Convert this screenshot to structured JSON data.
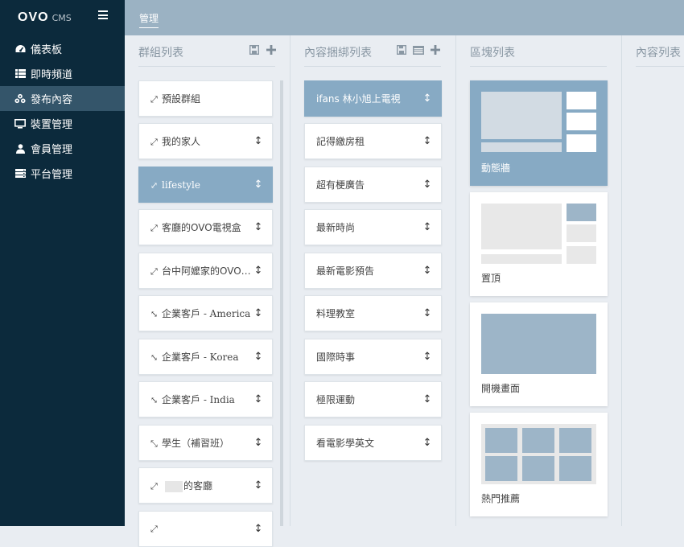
{
  "brand": {
    "logo": "OVO",
    "sub": "CMS"
  },
  "nav": [
    {
      "label": "儀表板",
      "icon": "dashboard-icon"
    },
    {
      "label": "即時頻道",
      "icon": "list-icon"
    },
    {
      "label": "發布內容",
      "icon": "share-nodes-icon",
      "active": true
    },
    {
      "label": "裝置管理",
      "icon": "monitor-icon"
    },
    {
      "label": "會員管理",
      "icon": "user-icon"
    },
    {
      "label": "平台管理",
      "icon": "server-icon"
    }
  ],
  "breadcrumb": "管理",
  "columns": {
    "groups": {
      "title": "群組列表",
      "items": [
        {
          "label": "預設群組",
          "icon": "expand-icon",
          "sortable": false
        },
        {
          "label": "我的家人",
          "icon": "expand-icon",
          "sortable": true
        },
        {
          "label": "lifestyle",
          "icon": "expand-icon",
          "sortable": true,
          "selected": true
        },
        {
          "label": "客廳的OVO電視盒",
          "icon": "expand-icon",
          "sortable": true
        },
        {
          "label": "台中阿嬤家的OVO…",
          "icon": "expand-icon",
          "sortable": true
        },
        {
          "label": "企業客戶 - America",
          "icon": "compress-icon",
          "sortable": true
        },
        {
          "label": "企業客戶 - Korea",
          "icon": "compress-icon",
          "sortable": true
        },
        {
          "label": "企業客戶 - India",
          "icon": "compress-icon",
          "sortable": true
        },
        {
          "label": "學生（補習班）",
          "icon": "compress-icon",
          "sortable": true
        },
        {
          "label": "的客廳",
          "icon": "expand-icon",
          "sortable": true
        },
        {
          "label": "",
          "icon": "expand-icon",
          "sortable": true
        }
      ]
    },
    "bundles": {
      "title": "內容捆綁列表",
      "items": [
        {
          "label": "ifans 林小旭上電視",
          "selected": true
        },
        {
          "label": "記得繳房租"
        },
        {
          "label": "超有梗廣告"
        },
        {
          "label": "最新時尚"
        },
        {
          "label": "最新電影預告"
        },
        {
          "label": "料理教室"
        },
        {
          "label": "國際時事"
        },
        {
          "label": "極限運動"
        },
        {
          "label": "看電影學英文"
        }
      ]
    },
    "blocks": {
      "title": "區塊列表",
      "items": [
        {
          "label": "動態牆",
          "selected": true
        },
        {
          "label": "置頂"
        },
        {
          "label": "開機畫面"
        },
        {
          "label": "熱門推薦"
        }
      ]
    },
    "contents": {
      "title": "內容列表"
    }
  },
  "colors": {
    "sidebar": "#0c2a3c",
    "active_nav": "#34556a",
    "topbar": "#9bb2c3",
    "selected": "#87aac4"
  }
}
